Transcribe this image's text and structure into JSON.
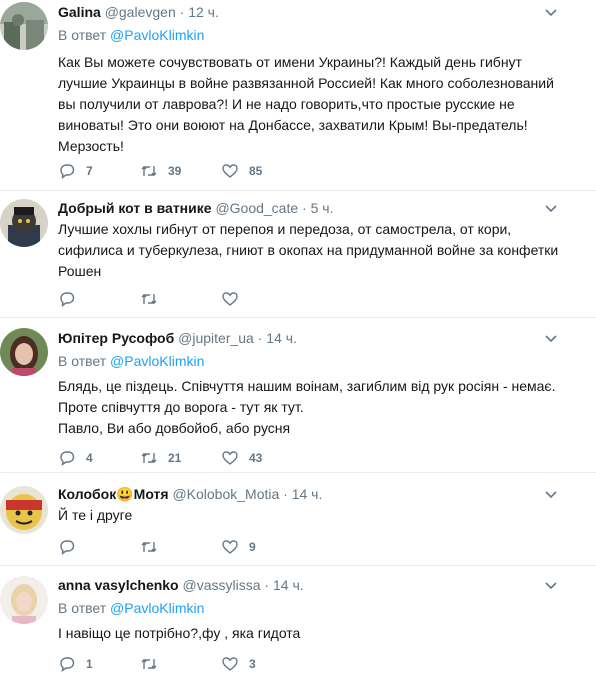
{
  "tweets": [
    {
      "name": "Galina",
      "handle": "@galevgen",
      "time": "12 ч.",
      "reply_prefix": "В ответ",
      "reply_mention": "@PavloKlimkin",
      "lines": [
        "Как Вы можете сочувствовать от имени Украины?! Каждый день гибнут",
        "лучшие Украинцы в войне развязанной Россией! Как много соболезнований",
        "вы получили от лаврова?! И не надо говорить,что простые русские не",
        "виноваты! Это они воюют на Донбассе, захватили Крым! Вы-предатель!",
        "Мерзость!"
      ],
      "replies": "7",
      "retweets": "39",
      "likes": "85"
    },
    {
      "name": "Добрый кот в ватнике",
      "handle": "@Good_cate",
      "time": "5 ч.",
      "lines": [
        "Лучшие хохлы гибнут от перепоя и передоза, от самострела, от кори,",
        "сифилиса и туберкулеза, гниют в окопах на придуманной войне за конфетки",
        "Рошен"
      ],
      "replies": "",
      "retweets": "",
      "likes": ""
    },
    {
      "name": "Юпітер Русофоб",
      "handle": "@jupiter_ua",
      "time": "14 ч.",
      "reply_prefix": "В ответ",
      "reply_mention": "@PavloKlimkin",
      "lines": [
        "Блядь, це пiздець. Спiвчуття нашим воiнам, загиблим вiд рук росiян - немає.",
        "Проте спiвчуття до ворога - тут як тут.",
        "Павло, Ви або довбойоб, або русня"
      ],
      "replies": "4",
      "retweets": "21",
      "likes": "43"
    },
    {
      "name_a": "Колобок",
      "name_emoji": "😃",
      "name_b": "Мотя",
      "handle": "@Kolobok_Motia",
      "time": "14 ч.",
      "lines": [
        "Й те і друге"
      ],
      "replies": "",
      "retweets": "",
      "likes": "9"
    },
    {
      "name": "anna vasylchenko",
      "handle": "@vassylissa",
      "time": "14 ч.",
      "reply_prefix": "В ответ",
      "reply_mention": "@PavloKlimkin",
      "lines": [
        "І навiщо це потрiбно?,фу , яка гидота"
      ],
      "replies": "1",
      "retweets": "",
      "likes": "3"
    }
  ],
  "dot": "·",
  "colors": {
    "accent": "#1da1f2",
    "muted": "#657786",
    "text": "#14171a",
    "divider": "#e6ecf0"
  }
}
